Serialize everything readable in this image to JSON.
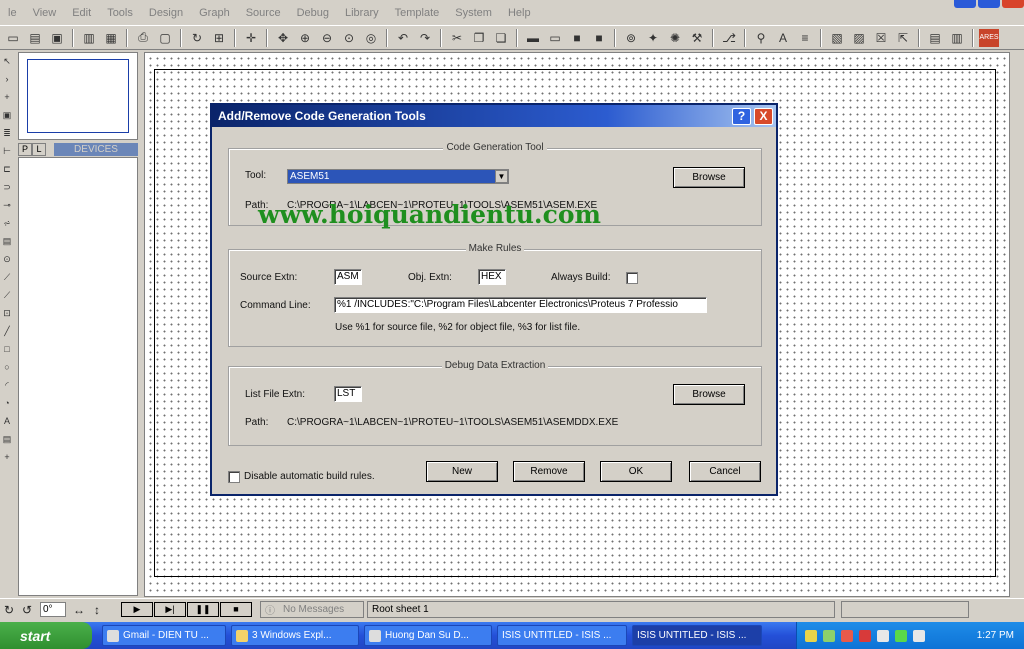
{
  "menu": [
    "le",
    "View",
    "Edit",
    "Tools",
    "Design",
    "Graph",
    "Source",
    "Debug",
    "Library",
    "Template",
    "System",
    "Help"
  ],
  "device_panel": {
    "tab_p": "P",
    "tab_l": "L",
    "title": "DEVICES"
  },
  "status": {
    "rotation": "0°",
    "messages": "No Messages",
    "sheet": "Root sheet 1"
  },
  "taskbar": {
    "start": "start",
    "tasks": [
      "Gmail - DIEN TU ...",
      "3 Windows Expl...",
      "Huong Dan Su D...",
      "ISIS UNTITLED - ISIS ...",
      "ISIS UNTITLED - ISIS ..."
    ],
    "clock": "1:27 PM"
  },
  "dialog": {
    "title": "Add/Remove Code Generation Tools",
    "help": "?",
    "close": "X",
    "codegen": {
      "group_title": "Code Generation Tool",
      "tool_label": "Tool:",
      "tool_value": "ASEM51",
      "browse": "Browse",
      "path_label": "Path:",
      "path_value": "C:\\PROGRA~1\\LABCEN~1\\PROTEU~1\\TOOLS\\ASEM51\\ASEM.EXE"
    },
    "make": {
      "group_title": "Make Rules",
      "source_label": "Source Extn:",
      "source_value": "ASM",
      "obj_label": "Obj. Extn:",
      "obj_value": "HEX",
      "always_label": "Always Build:",
      "cmd_label": "Command Line:",
      "cmd_value": "%1 /INCLUDES:\"C:\\Program Files\\Labcenter Electronics\\Proteus 7 Professio",
      "hint": "Use %1 for source file, %2 for object file, %3 for list file."
    },
    "debug": {
      "group_title": "Debug Data Extraction",
      "list_label": "List File Extn:",
      "list_value": "LST",
      "browse": "Browse",
      "path_label": "Path:",
      "path_value": "C:\\PROGRA~1\\LABCEN~1\\PROTEU~1\\TOOLS\\ASEM51\\ASEMDDX.EXE"
    },
    "disable_label": "Disable automatic build rules.",
    "new": "New",
    "remove": "Remove",
    "ok": "OK",
    "cancel": "Cancel"
  },
  "watermark": "www.hoiquandientu.com"
}
